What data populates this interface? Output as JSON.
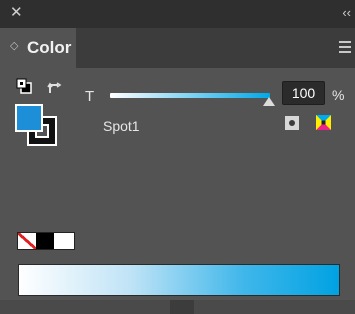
{
  "titlebar": {
    "close_glyph": "✕",
    "collapse_glyph": "‹‹"
  },
  "tab": {
    "label": "Color",
    "arrows_glyph": "◇"
  },
  "controls": {
    "tint_letter": "T",
    "tint_value": "100",
    "tint_unit": "%",
    "tint_fraction": 1.0,
    "swatch_name": "Spot1",
    "fill_color": "#1c8fd8",
    "stroke_color": "#111111",
    "spot_color": "#00a8e8"
  },
  "icons": {
    "default_fill_stroke": "default-fill-stroke-icon",
    "swap": "swap-fill-stroke-icon",
    "spot": "spot-color-icon",
    "process": "process-color-icon",
    "menu": "panel-menu-icon"
  },
  "swatches": {
    "none": "None",
    "black": "Black",
    "white": "White"
  }
}
